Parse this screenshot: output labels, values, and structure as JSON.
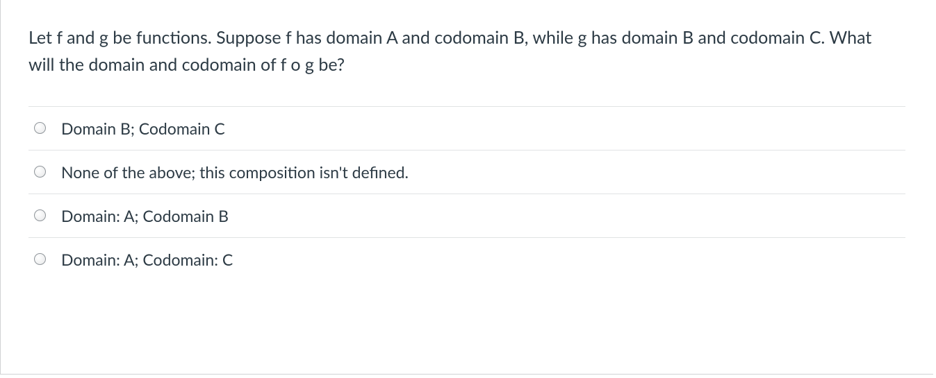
{
  "question": {
    "text": "Let f and g be functions. Suppose f has domain A and codomain B, while g has domain B and codomain C. What will the domain and codomain of f o g be?"
  },
  "options": [
    {
      "label": "Domain B; Codomain C"
    },
    {
      "label": "None of the above; this composition isn't defined."
    },
    {
      "label": "Domain: A; Codomain B"
    },
    {
      "label": "Domain: A; Codomain: C"
    }
  ]
}
